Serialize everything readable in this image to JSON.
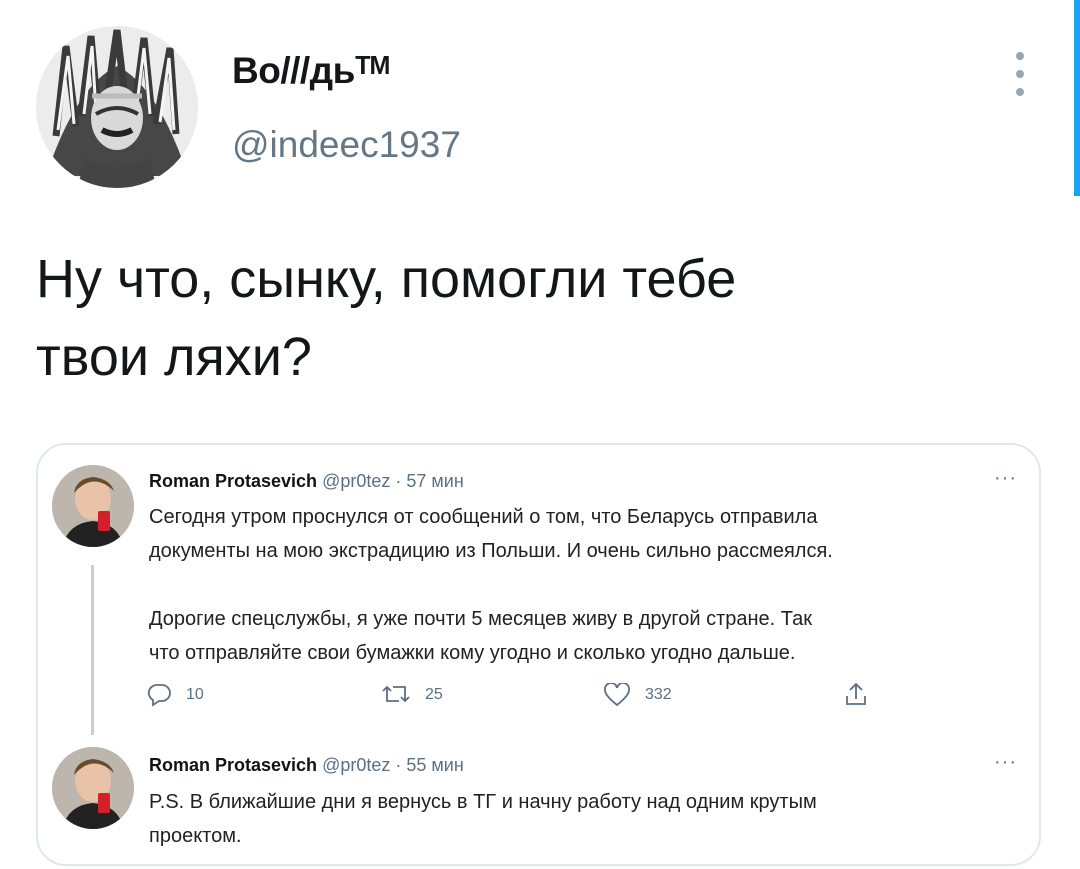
{
  "tweet": {
    "author_name": "Во///дьᵀᴹ",
    "author_handle": "@indeec1937",
    "text": "Ну что, сынку, помогли тебе\nтвои ляхи?"
  },
  "quote": {
    "first": {
      "name": "Roman Protasevich",
      "handle": "@pr0tez",
      "time": "· 57 мин",
      "text": "Сегодня утром проснулся от сообщений о том, что Беларусь отправила\nдокументы на мою экстрадицию из Польши. И очень сильно рассмеялся.\n\nДорогие спецслужбы, я уже почти 5 месяцев живу в другой стране. Так\nчто отправляйте свои бумажки кому угодно и сколько угодно дальше.",
      "replies": "10",
      "retweets": "25",
      "likes": "332"
    },
    "second": {
      "name": "Roman Protasevich",
      "handle": "@pr0tez",
      "time": "· 55 мин",
      "text": "P.S. В ближайшие дни я вернусь в ТГ и начну работу над одним крутым\nпроектом."
    },
    "more_glyph": "···"
  },
  "icons": {
    "more": "more-vertical-icon",
    "reply": "reply-icon",
    "retweet": "retweet-icon",
    "like": "like-icon",
    "share": "share-icon"
  },
  "colors": {
    "accent": "#1da1f2",
    "muted": "#657786",
    "border": "#e1e8ed"
  }
}
